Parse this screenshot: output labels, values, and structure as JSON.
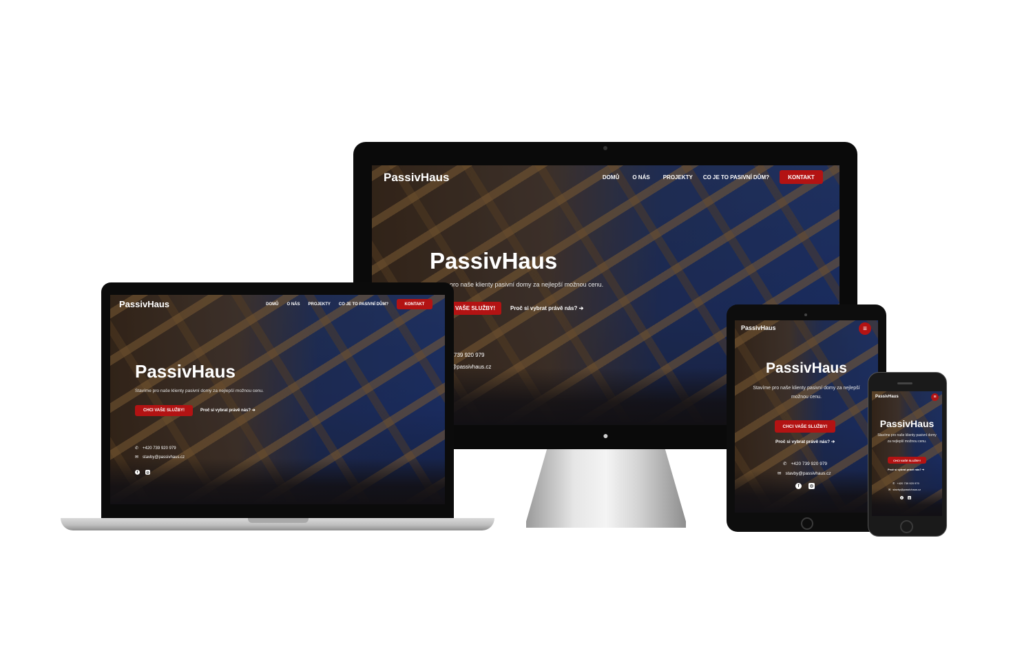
{
  "site": {
    "brand": "PassivHaus",
    "nav": {
      "home": "DOMŮ",
      "about": "O NÁS",
      "projects": "PROJEKTY",
      "passive": "CO JE TO PASIVNÍ DŮM?",
      "contact": "KONTAKT"
    },
    "hero": {
      "title": "PassivHaus",
      "subtitle": "Stavíme pro naše klienty pasivní domy za nejlepší možnou cenu.",
      "cta": "CHCI VAŠE SLUŽBY!",
      "why": "Proč si vybrat právě nás? ➔"
    },
    "contact": {
      "phone": "+420 739 920 979",
      "email": "stavby@passivhaus.cz"
    }
  },
  "imac_partial": {
    "subtitle": "oro naše klienty pasivní domy za nejlepší možnou cenu.",
    "cta": "VAŠE SLUŽBY!",
    "phone": "739 920 979",
    "email": "y@passivhaus.cz"
  },
  "icons": {
    "phone": "phone-icon",
    "email": "envelope-icon",
    "facebook": "facebook-icon",
    "instagram": "instagram-icon",
    "menu": "hamburger-icon",
    "apple": "apple-logo-icon"
  },
  "colors": {
    "accent": "#b31313",
    "bezel": "#0a0a0a",
    "text": "#ffffff"
  }
}
